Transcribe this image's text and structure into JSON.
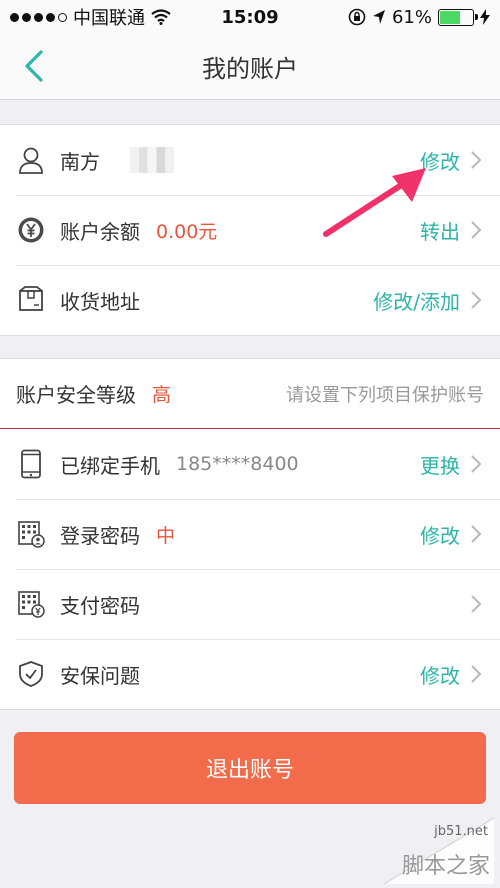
{
  "status_bar": {
    "carrier": "中国联通",
    "time": "15:09",
    "battery_percent": "61%",
    "battery_level": 0.61
  },
  "navbar": {
    "title": "我的账户"
  },
  "account": {
    "name": "南方",
    "balance_label": "账户余额",
    "balance_value": "0.00元",
    "address_label": "收货地址",
    "modify": "修改",
    "withdraw": "转出",
    "modify_add": "修改/添加"
  },
  "security": {
    "level_label": "账户安全等级",
    "level_value": "高",
    "hint": "请设置下列项目保护账号",
    "phone_label": "已绑定手机",
    "phone_value": "185****8400",
    "phone_action": "更换",
    "login_pwd_label": "登录密码",
    "login_pwd_level": "中",
    "login_pwd_action": "修改",
    "pay_pwd_label": "支付密码",
    "question_label": "安保问题",
    "question_action": "修改"
  },
  "logout_label": "退出账号",
  "watermark": {
    "url": "jb51.net",
    "text": "脚本之家"
  },
  "colors": {
    "accent": "#2cb5a8",
    "danger": "#e8553a",
    "logout": "#f26b4a",
    "annotation_arrow": "#f0326a"
  },
  "icons": {
    "back": "chevron-left-icon",
    "user": "user-icon",
    "balance": "yen-coin-icon",
    "address": "package-icon",
    "phone": "phone-icon",
    "login_password": "keypad-user-icon",
    "pay_password": "keypad-yen-icon",
    "security_question": "shield-check-icon"
  }
}
